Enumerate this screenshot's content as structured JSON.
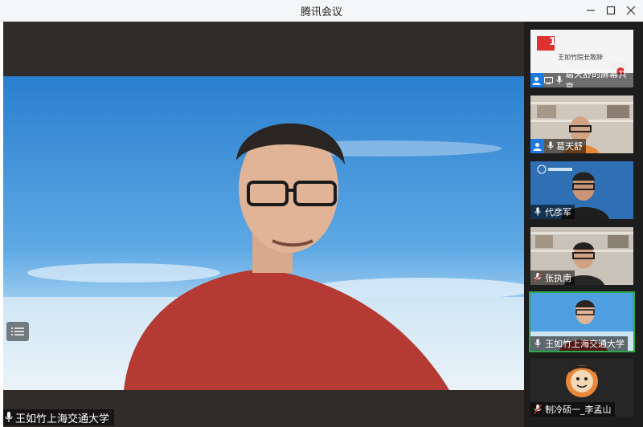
{
  "window": {
    "title": "腾讯会议"
  },
  "main": {
    "speaker_name": "王如竹上海交通大学"
  },
  "sidebar": {
    "tiles": [
      {
        "label": "葛天舒的屏幕共享",
        "slide_title": "王如竹院长致辞",
        "slide_number": "1"
      },
      {
        "label": "葛天舒"
      },
      {
        "label": "代彦军"
      },
      {
        "label": "张执南"
      },
      {
        "label": "王如竹上海交通大学"
      },
      {
        "label": "制冷硕一_李孟山"
      }
    ]
  },
  "colors": {
    "accent_blue": "#1f7ae0",
    "active_border": "#2ea64a",
    "muted_red": "#d23c3c",
    "slide_red": "#e03131"
  }
}
